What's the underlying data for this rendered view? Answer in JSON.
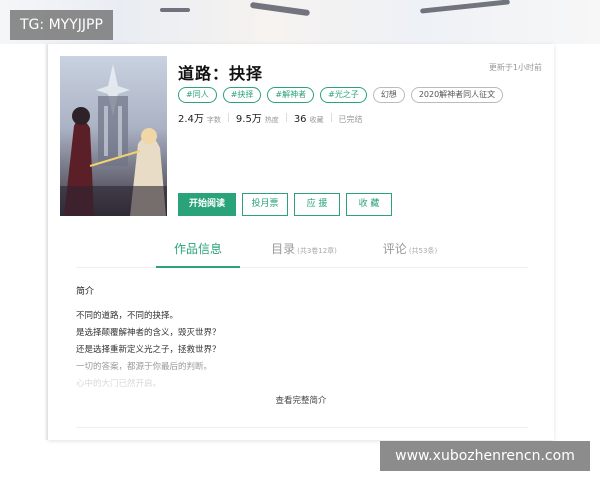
{
  "watermarks": {
    "top_left": "TG: MYYJJPP",
    "bottom_right": "www.xubozhenrencn.com"
  },
  "book": {
    "title": "道路：抉择",
    "update_time": "更新于1小时前",
    "tags": [
      {
        "label": "#同人",
        "style": "green"
      },
      {
        "label": "#抉择",
        "style": "green"
      },
      {
        "label": "#解神者",
        "style": "green"
      },
      {
        "label": "#光之子",
        "style": "green"
      },
      {
        "label": "幻想",
        "style": "gray"
      },
      {
        "label": "2020解神者同人征文",
        "style": "gray"
      }
    ],
    "stats": {
      "words": {
        "value": "2.4万",
        "unit": "字数"
      },
      "heat": {
        "value": "9.5万",
        "unit": "热度"
      },
      "favorites": {
        "value": "36",
        "unit": "收藏"
      },
      "status": "已完结"
    },
    "actions": {
      "start_reading": "开始阅读",
      "monthly_ticket": "投月票",
      "support": "应 援",
      "collect": "收 藏"
    }
  },
  "tabs": [
    {
      "label": "作品信息",
      "sub": "",
      "active": true
    },
    {
      "label": "目录",
      "sub": "(共3卷12章)",
      "active": false
    },
    {
      "label": "评论",
      "sub": "(共53条)",
      "active": false
    }
  ],
  "intro": {
    "heading": "简介",
    "lines": [
      "不同的道路，不同的抉择。",
      "是选择颠覆解神者的含义，毁灭世界？",
      "还是选择重新定义光之子，拯救世界？",
      "一切的答案，都源于你最后的判断。",
      "心中的大门已然开启。"
    ],
    "more_link": "查看完整简介"
  },
  "colors": {
    "accent": "#2aa37a",
    "muted": "#999999"
  }
}
